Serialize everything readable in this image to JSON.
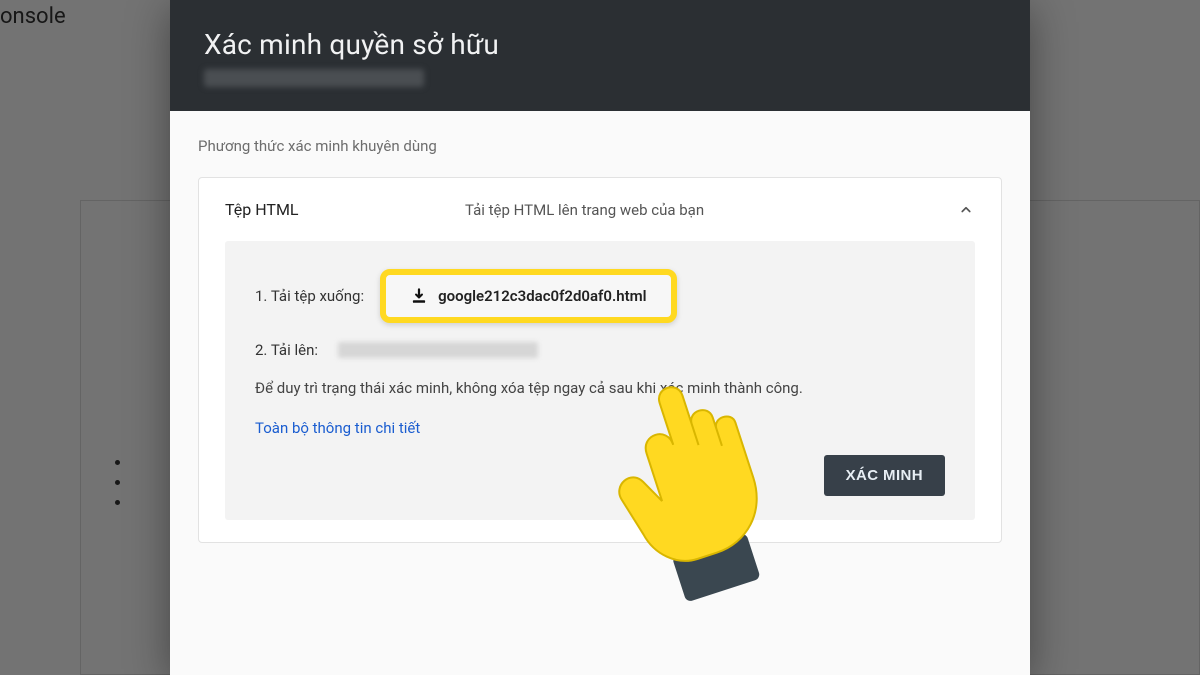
{
  "background": {
    "title_fragment": "onsole"
  },
  "dialog": {
    "title": "Xác minh quyền sở hữu",
    "section_label": "Phương thức xác minh khuyên dùng",
    "method": {
      "name": "Tệp HTML",
      "description": "Tải tệp HTML lên trang web của bạn"
    },
    "steps": {
      "download_label": "1. Tải tệp xuống:",
      "download_filename": "google212c3dac0f2d0af0.html",
      "upload_label": "2. Tải lên:"
    },
    "note": "Để duy trì trạng thái xác minh, không xóa tệp ngay cả sau khi xác minh thành công.",
    "details_link": "Toàn bộ thông tin chi tiết",
    "verify_button": "XÁC MINH"
  }
}
